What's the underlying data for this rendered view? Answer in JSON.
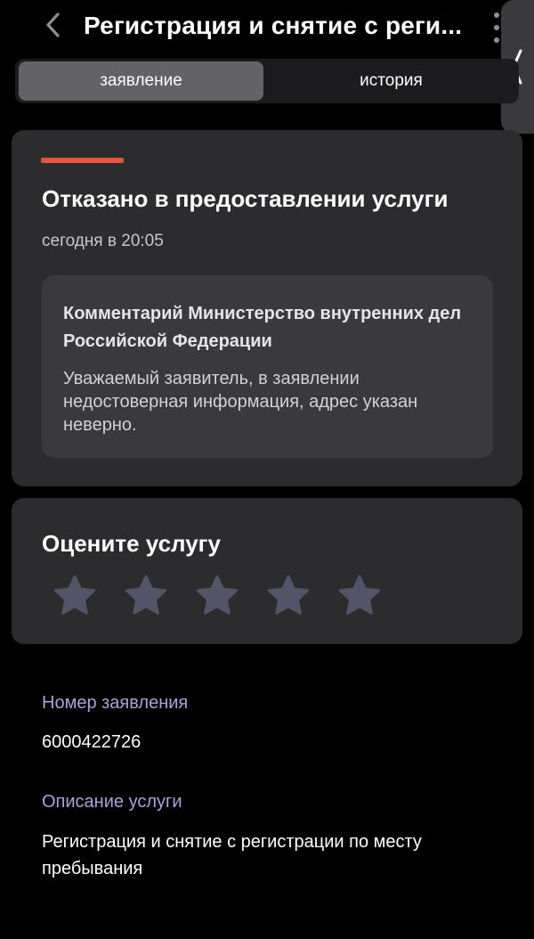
{
  "header": {
    "title": "Регистрация и снятие с реги...",
    "back_icon": "chevron-left-icon",
    "more_icon": "more-vertical-icon",
    "edge_handle_icon": "chevron-left-icon"
  },
  "tabs": [
    {
      "label": "заявление",
      "active": true
    },
    {
      "label": "история",
      "active": false
    }
  ],
  "status": {
    "accent_color": "#e5533d",
    "title": "Отказано в предоставлении услуги",
    "date": "сегодня в 20:05",
    "comment": {
      "title": "Комментарий Министерство внутренних дел Российской Федерации",
      "text": "Уважаемый заявитель, в заявлении недостоверная информация, адрес указан неверно."
    }
  },
  "rating": {
    "title": "Оцените услугу",
    "max_stars": 5,
    "selected": 0,
    "star_color": "#545468"
  },
  "details": {
    "number_label": "Номер заявления",
    "number_value": "6000422726",
    "description_label": "Описание услуги",
    "description_value": "Регистрация и снятие с регистрации по месту пребывания"
  }
}
